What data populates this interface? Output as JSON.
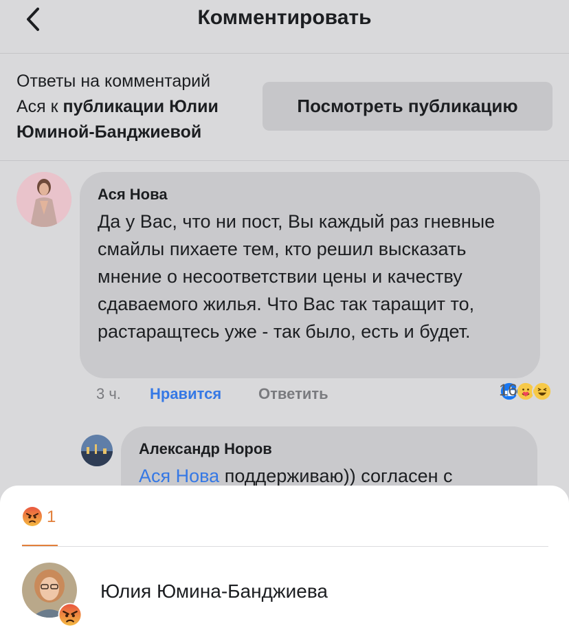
{
  "header": {
    "title": "Комментировать"
  },
  "context": {
    "line1": "Ответы на комментарий",
    "line2_prefix": "Ася к ",
    "line2_bold": "публикации Юлии",
    "line3_bold": "Юминой-Банджиевой",
    "view_post_label": "Посмотреть публикацию"
  },
  "comment": {
    "author": "Ася Нова",
    "text": "Да у Вас, что ни пост, Вы каждый раз гневные смайлы пихаете тем, кто решил высказать мнение о несоответствии цены и качеству сдаваемого жилья. Что Вас так таращит то, растаращтесь уже - так было, есть и будет.",
    "time": "3 ч.",
    "like_label": "Нравится",
    "reply_label": "Ответить",
    "reaction_count": "16",
    "reaction_icons": [
      "like-icon",
      "care-icon",
      "haha-icon"
    ]
  },
  "reply": {
    "author": "Александр Норов",
    "mention": "Ася Нова",
    "text": " поддерживаю)) согласен с"
  },
  "reactions_sheet": {
    "tab_icon": "angry-icon",
    "tab_count": "1",
    "user_name": "Юлия Юмина-Банджиева",
    "user_reaction_icon": "angry-icon"
  },
  "colors": {
    "background": "#d9d9db",
    "accent_blue": "#3578e5",
    "angry_orange": "#e27f3a"
  }
}
